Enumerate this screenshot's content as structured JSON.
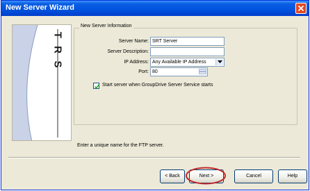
{
  "window": {
    "title": "New Server Wizard"
  },
  "banner": {
    "letters": [
      "T",
      "R",
      "S"
    ]
  },
  "group": {
    "legend": "New Server Information"
  },
  "fields": {
    "server_name_label": "Server Name:",
    "server_name_value": "SRT Server",
    "server_description_label": "Server Description:",
    "server_description_value": "",
    "ip_address_label": "IP Address:",
    "ip_address_value": "Any Available IP Address",
    "port_label": "Port:",
    "port_value": "80"
  },
  "checkbox": {
    "label": "Start server when GroupDrive Server Service starts",
    "checked": true
  },
  "hint": "Enter a unique name for the FTP server.",
  "buttons": {
    "back": "< Back",
    "next": "Next >",
    "cancel": "Cancel",
    "help": "Help"
  },
  "colors": {
    "titlebar": "#0153de",
    "dialog_bg": "#ece9d8",
    "close_button": "#e2471f",
    "highlight_circle": "#c0282a"
  }
}
